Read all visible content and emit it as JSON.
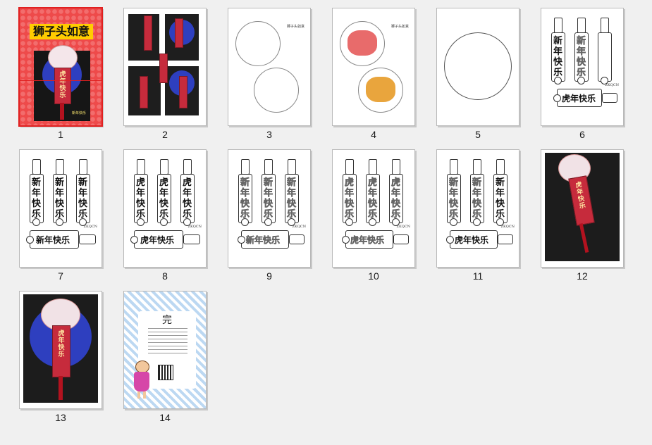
{
  "pages": [
    {
      "num": "1",
      "title": "狮子头如意",
      "footer": "新年快乐"
    },
    {
      "num": "2"
    },
    {
      "num": "3",
      "brand": "狮子头如意"
    },
    {
      "num": "4",
      "brand": "狮子头如意"
    },
    {
      "num": "5"
    },
    {
      "num": "6",
      "tag_text": "新年快乐",
      "tag_text2": "虎年快乐",
      "brand": "ZKQCN"
    },
    {
      "num": "7",
      "tag_text": "新年快乐",
      "tag_text2": "新年快乐",
      "brand": "ZKQCN"
    },
    {
      "num": "8",
      "tag_text": "虎年快乐",
      "tag_text2": "虎年快乐",
      "brand": "ZKQCN"
    },
    {
      "num": "9",
      "tag_text": "新年快乐",
      "brand": "ZKQCN"
    },
    {
      "num": "10",
      "tag_text": "虎年快乐",
      "brand": "ZKQCN"
    },
    {
      "num": "11",
      "tag_text": "新年快乐",
      "tag_text2": "虎年快乐",
      "brand": "ZKQCN"
    },
    {
      "num": "12",
      "red_tag": "虎年快乐"
    },
    {
      "num": "13",
      "red_tag": "虎年快乐"
    },
    {
      "num": "14",
      "end_title": "完"
    }
  ],
  "selected_page": "1",
  "colors": {
    "accent": "#e02020",
    "cover_bg": "#ee4a4a",
    "title_bg": "#ffcc00",
    "blue": "#2e3fbf"
  }
}
